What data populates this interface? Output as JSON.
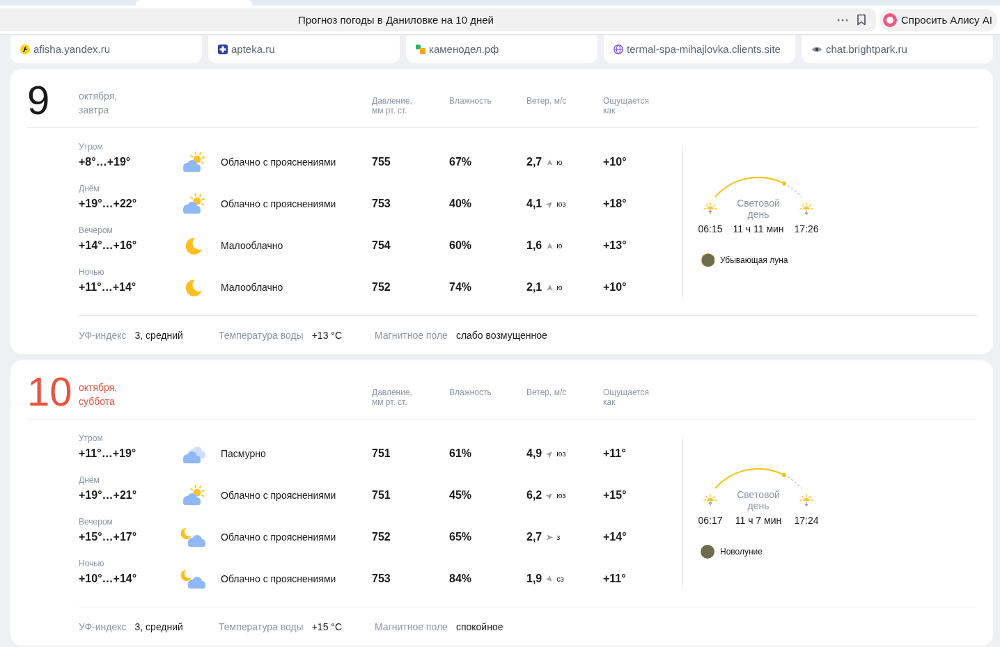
{
  "browser": {
    "page_title": "Прогноз погоды в Даниловке на 10 дней",
    "assistant_button": "Спросить Алису AI"
  },
  "bookmarks": [
    {
      "label": "afisha.yandex.ru",
      "kind": "figure"
    },
    {
      "label": "apteka.ru",
      "kind": "cross"
    },
    {
      "label": "каменодел.рф",
      "kind": "squares"
    },
    {
      "label": "termal-spa-mihajlovka.clients.site",
      "kind": "globe"
    },
    {
      "label": "chat.brightpark.ru",
      "kind": "eye"
    }
  ],
  "days": [
    {
      "day": "9",
      "date": "октября, завтра",
      "weekend": false,
      "columns": [
        "Давление, мм рт. ст.",
        "Влажность",
        "Ветер, м/с",
        "Ощущается как"
      ],
      "periods": [
        {
          "name": "Утром",
          "temp": "+8°…+19°",
          "kind": "cloud-sun",
          "condition": "Облачно с прояснениями",
          "pressure": "755",
          "humidity": "67%",
          "wind": {
            "speed": "2,7",
            "kind": "n",
            "direction": "ю"
          },
          "feels_like": "+10°"
        },
        {
          "name": "Днём",
          "temp": "+19°…+22°",
          "kind": "cloud-sun",
          "condition": "Облачно с прояснениями",
          "pressure": "753",
          "humidity": "40%",
          "wind": {
            "speed": "4,1",
            "kind": "ne",
            "direction": "юз"
          },
          "feels_like": "+18°"
        },
        {
          "name": "Вечером",
          "temp": "+14°…+16°",
          "kind": "moon",
          "condition": "Малооблачно",
          "pressure": "754",
          "humidity": "60%",
          "wind": {
            "speed": "1,6",
            "kind": "n",
            "direction": "ю"
          },
          "feels_like": "+13°"
        },
        {
          "name": "Ночью",
          "temp": "+11°…+14°",
          "kind": "moon",
          "condition": "Малооблачно",
          "pressure": "752",
          "humidity": "74%",
          "wind": {
            "speed": "2,1",
            "kind": "n",
            "direction": "ю"
          },
          "feels_like": "+10°"
        }
      ],
      "daylight": {
        "label": "Световой день",
        "sunrise": "06:15",
        "duration": "11 ч 11 мин",
        "sunset": "17:26"
      },
      "moon": {
        "kind": "waning",
        "label": "Убывающая луна"
      },
      "details": [
        {
          "label": "УФ-индекс",
          "value": "3, средний"
        },
        {
          "label": "Температура воды",
          "value": "+13 °C"
        },
        {
          "label": "Магнитное поле",
          "value": "слабо возмущенное"
        }
      ]
    },
    {
      "day": "10",
      "date": "октября, суббота",
      "weekend": true,
      "columns": [
        "Давление, мм рт. ст.",
        "Влажность",
        "Ветер, м/с",
        "Ощущается как"
      ],
      "periods": [
        {
          "name": "Утром",
          "temp": "+11°…+19°",
          "kind": "clouds",
          "condition": "Пасмурно",
          "pressure": "751",
          "humidity": "61%",
          "wind": {
            "speed": "4,9",
            "kind": "ne",
            "direction": "юз"
          },
          "feels_like": "+11°"
        },
        {
          "name": "Днём",
          "temp": "+19°…+21°",
          "kind": "cloud-sun",
          "condition": "Облачно с прояснениями",
          "pressure": "751",
          "humidity": "45%",
          "wind": {
            "speed": "6,2",
            "kind": "ne",
            "direction": "юз"
          },
          "feels_like": "+15°"
        },
        {
          "name": "Вечером",
          "temp": "+15°…+17°",
          "kind": "cloud-moon",
          "condition": "Облачно с прояснениями",
          "pressure": "752",
          "humidity": "65%",
          "wind": {
            "speed": "2,7",
            "kind": "e",
            "direction": "з"
          },
          "feels_like": "+14°"
        },
        {
          "name": "Ночью",
          "temp": "+10°…+14°",
          "kind": "cloud-moon",
          "condition": "Облачно с прояснениями",
          "pressure": "753",
          "humidity": "84%",
          "wind": {
            "speed": "1,9",
            "kind": "se",
            "direction": "сз"
          },
          "feels_like": "+11°"
        }
      ],
      "daylight": {
        "label": "Световой день",
        "sunrise": "06:17",
        "duration": "11 ч 7 мин",
        "sunset": "17:24"
      },
      "moon": {
        "kind": "new",
        "label": "Новолуние"
      },
      "details": [
        {
          "label": "УФ-индекс",
          "value": "3, средний"
        },
        {
          "label": "Температура воды",
          "value": "+15 °C"
        },
        {
          "label": "Магнитное поле",
          "value": "спокойное"
        }
      ]
    }
  ]
}
